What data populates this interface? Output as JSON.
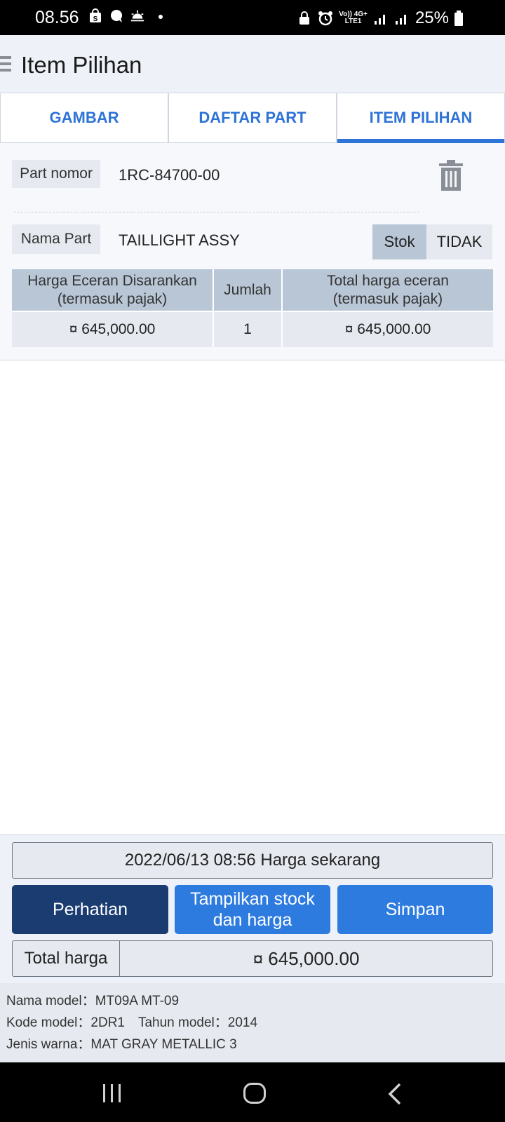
{
  "status_bar": {
    "time": "08.56",
    "network_top": "Vo)) 4G+",
    "network_bottom": "LTE1",
    "battery": "25%"
  },
  "header": {
    "title": "Item Pilihan"
  },
  "tabs": [
    {
      "label": "GAMBAR",
      "active": false
    },
    {
      "label": "DAFTAR PART",
      "active": false
    },
    {
      "label": "ITEM PILIHAN",
      "active": true
    }
  ],
  "item": {
    "part_number_label": "Part nomor",
    "part_number": "1RC-84700-00",
    "part_name_label": "Nama Part",
    "part_name": "TAILLIGHT ASSY",
    "stock_label": "Stok",
    "stock_value": "TIDAK",
    "table": {
      "headers": [
        "Harga Eceran Disarankan\n(termasuk pajak)",
        "Jumlah",
        "Total harga eceran\n(termasuk pajak)"
      ],
      "header_1_line1": "Harga Eceran Disarankan",
      "header_1_line2": "(termasuk pajak)",
      "header_2": "Jumlah",
      "header_3_line1": "Total harga eceran",
      "header_3_line2": "(termasuk pajak)",
      "unit_price": "¤ 645,000.00",
      "quantity": "1",
      "total_price": "¤ 645,000.00"
    }
  },
  "bottom": {
    "price_time": "2022/06/13 08:56 Harga sekarang",
    "attention_button": "Perhatian",
    "stock_button_line1": "Tampilkan stock",
    "stock_button_line2": "dan harga",
    "save_button": "Simpan",
    "total_label": "Total harga",
    "total_value": "¤ 645,000.00"
  },
  "model_info": {
    "model_name_label": "Nama model：",
    "model_name": "MT09A MT-09",
    "model_code_label": "Kode model：",
    "model_code": "2DR1",
    "model_year_label": "Tahun model：",
    "model_year": "2014",
    "color_label": "Jenis warna：",
    "color": "MAT GRAY METALLIC 3"
  },
  "colors": {
    "accent": "#2e7be0",
    "dark_button": "#1a3c70",
    "header_bg": "#eef2f8",
    "table_header": "#b9c6d6"
  }
}
